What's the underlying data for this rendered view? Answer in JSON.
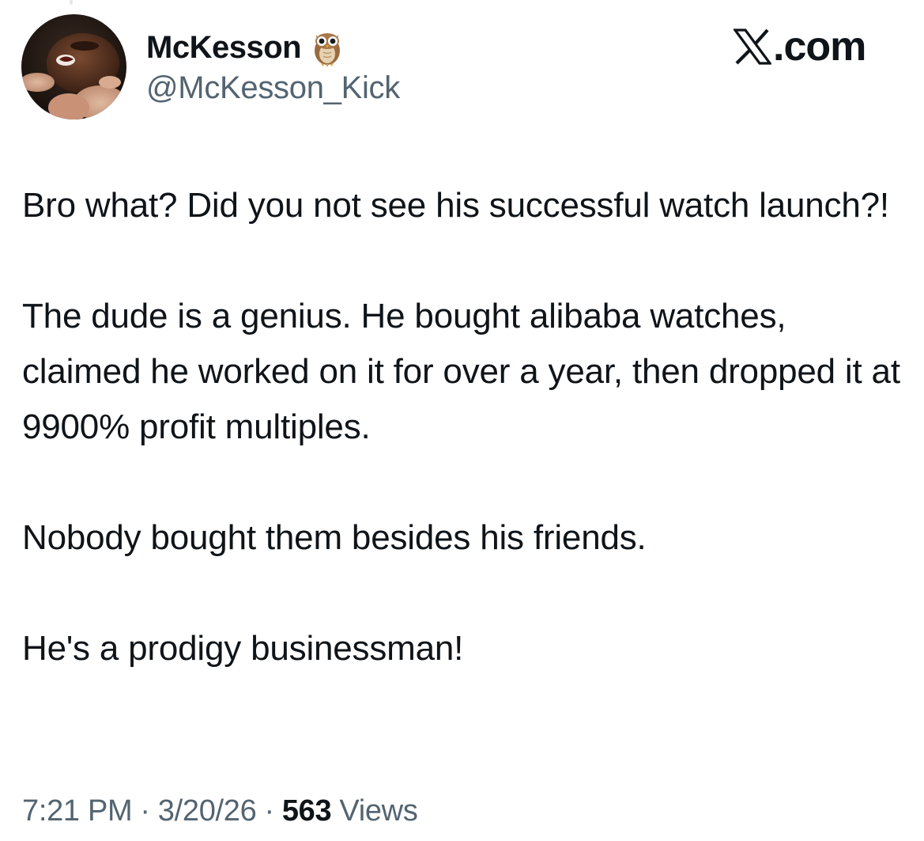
{
  "author": {
    "name": "McKesson",
    "handle": "@McKesson_Kick",
    "badge_icon": "owl-emoji-icon"
  },
  "brand": {
    "logo_icon": "x-logo-icon",
    "suffix": ".com"
  },
  "tweet": {
    "paragraphs": [
      "Bro what? Did you not see his successful watch launch?!",
      "The dude is a genius. He bought alibaba watches, claimed he worked on it for over a year, then dropped it at 9900% profit multiples.",
      "Nobody bought them besides his friends.",
      "He's a prodigy businessman!"
    ]
  },
  "meta": {
    "time": "7:21 PM",
    "separator": "·",
    "date": "3/20/26",
    "views_count": "563",
    "views_label": "Views"
  },
  "colors": {
    "text_primary": "#0f1419",
    "text_secondary": "#536471",
    "background": "#ffffff"
  }
}
